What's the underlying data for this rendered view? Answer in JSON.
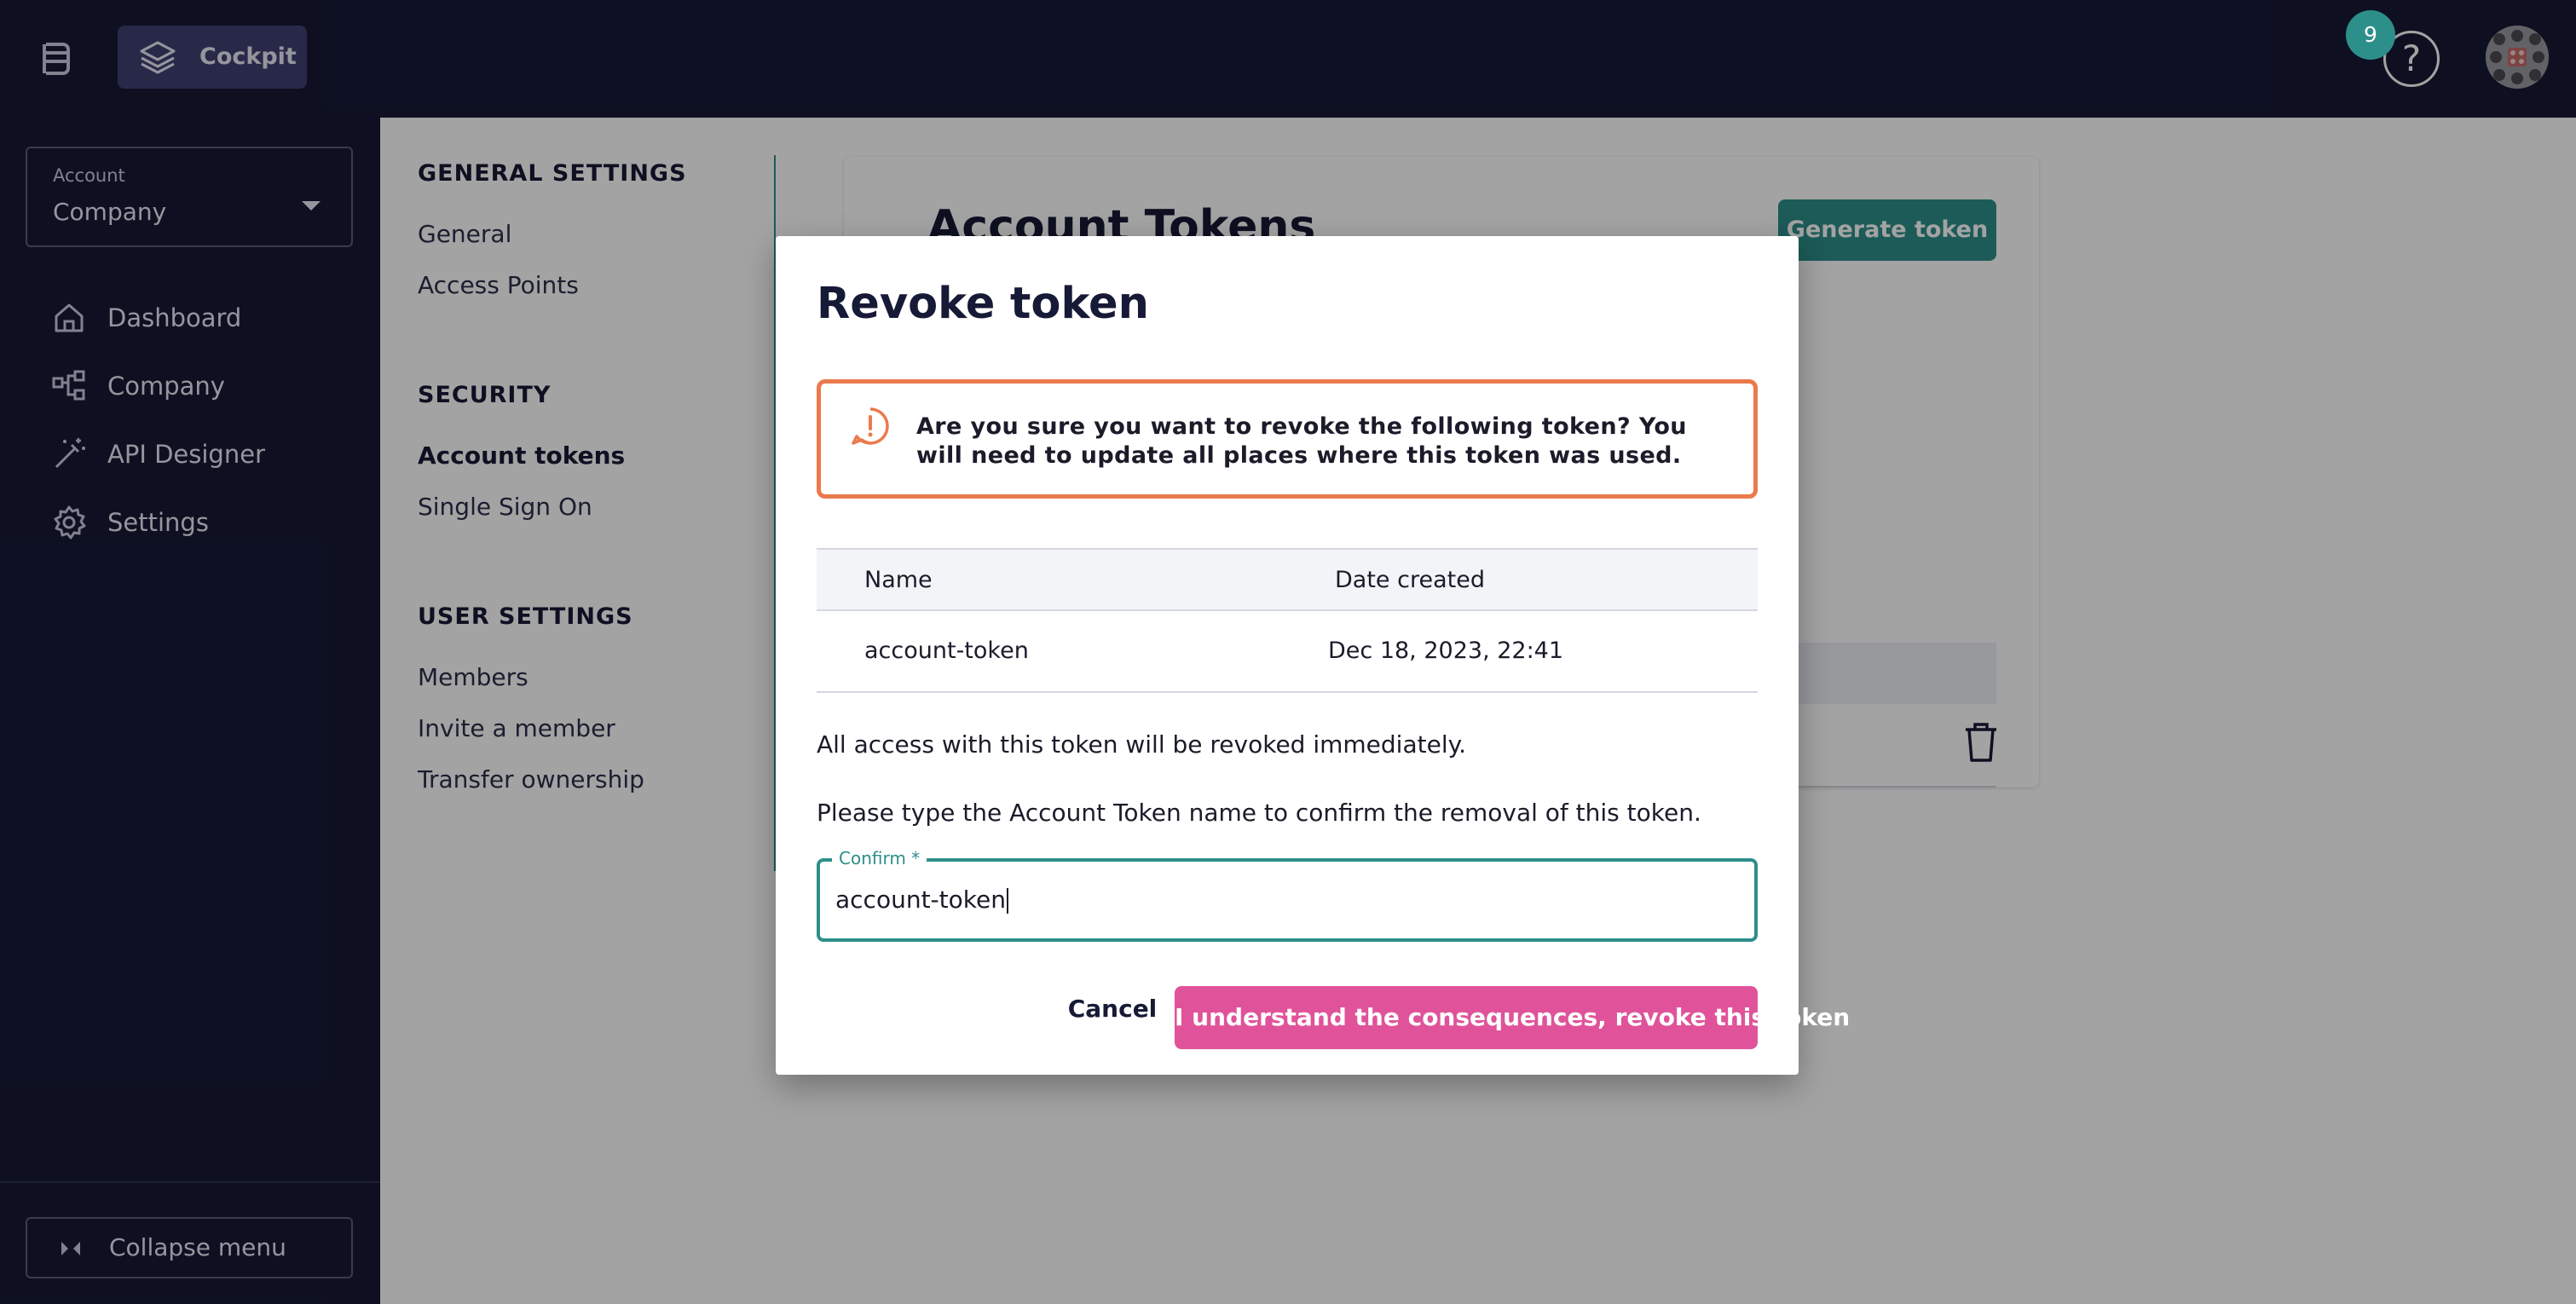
{
  "header": {
    "app_name": "Cockpit",
    "notification_count": "9",
    "help_label": "?"
  },
  "sidebar": {
    "account_select": {
      "caption": "Account",
      "value": "Company"
    },
    "items": [
      {
        "label": "Dashboard",
        "icon": "home-icon"
      },
      {
        "label": "Company",
        "icon": "org-chart-icon"
      },
      {
        "label": "API Designer",
        "icon": "magic-wand-icon"
      },
      {
        "label": "Settings",
        "icon": "gear-icon"
      }
    ],
    "collapse_label": "Collapse menu"
  },
  "settings_nav": {
    "general_heading": "GENERAL SETTINGS",
    "general_items": [
      "General",
      "Access Points"
    ],
    "security_heading": "SECURITY",
    "security_items": [
      "Account tokens",
      "Single Sign On"
    ],
    "user_heading": "USER SETTINGS",
    "user_items": [
      "Members",
      "Invite a member",
      "Transfer ownership"
    ],
    "active": "Account tokens"
  },
  "card": {
    "title": "Account Tokens",
    "generate_label": "Generate token"
  },
  "modal": {
    "title": "Revoke token",
    "warning": "Are you sure you want to revoke the following token? You will need to update all places where this token was used.",
    "table": {
      "headers": [
        "Name",
        "Date created"
      ],
      "rows": [
        [
          "account-token",
          "Dec 18, 2023, 22:41"
        ]
      ]
    },
    "info_text": "All access with this token will be revoked immediately.",
    "instruction": "Please type the Account Token name to confirm the removal of this token.",
    "confirm_label": "Confirm *",
    "confirm_value": "account-token",
    "cancel_label": "Cancel",
    "revoke_label": "I understand the consequences, revoke this token"
  },
  "colors": {
    "nav_bg": "#161a36",
    "accent_teal": "#2d8f8a",
    "warning_orange": "#ea7a4c",
    "danger_pink": "#e0539a"
  }
}
